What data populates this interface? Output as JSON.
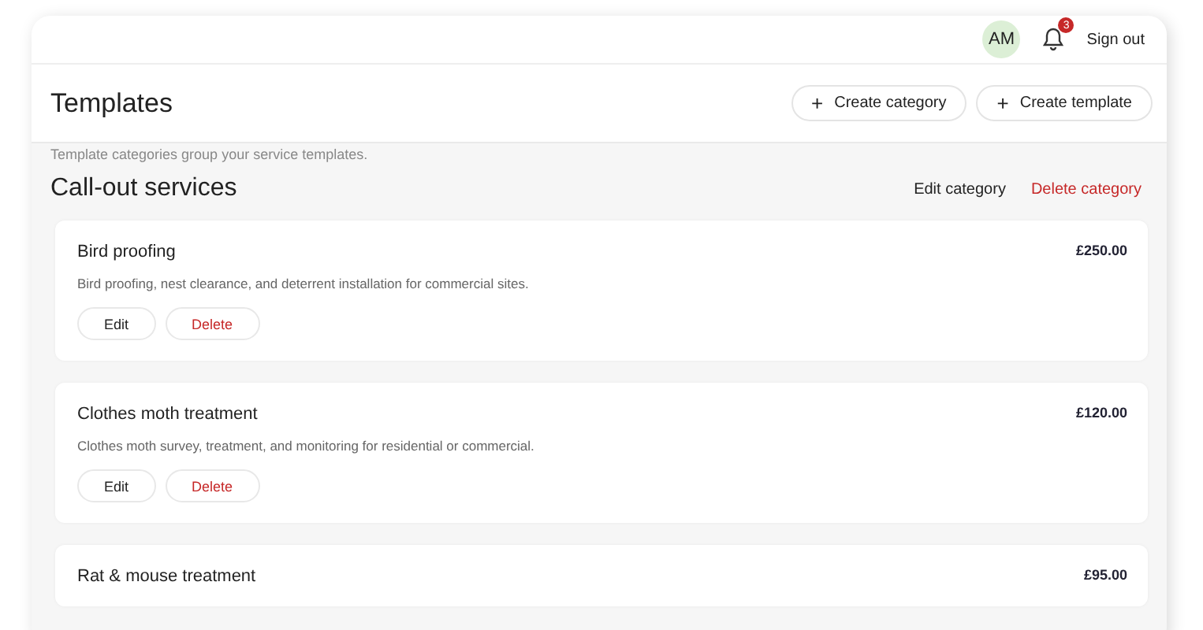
{
  "topbar": {
    "avatar": "AM",
    "notifications": "3",
    "sign_out": "Sign out"
  },
  "header": {
    "title": "Templates",
    "buttons": [
      {
        "icon": "+",
        "label": "Create category"
      },
      {
        "icon": "+",
        "label": "Create template"
      }
    ]
  },
  "intro": "Template categories group your service templates.",
  "category": {
    "name": "Call-out services",
    "edit": "Edit category",
    "delete": "Delete category"
  },
  "templates": [
    {
      "name": "Bird proofing",
      "price": "£250.00",
      "description": "Bird proofing, nest clearance, and deterrent installation for commercial sites.",
      "edit": "Edit",
      "delete": "Delete"
    },
    {
      "name": "Clothes moth treatment",
      "price": "£120.00",
      "description": "Clothes moth survey, treatment, and monitoring for residential or commercial.",
      "edit": "Edit",
      "delete": "Delete"
    },
    {
      "name": "Rat & mouse treatment",
      "price": "£95.00"
    }
  ]
}
